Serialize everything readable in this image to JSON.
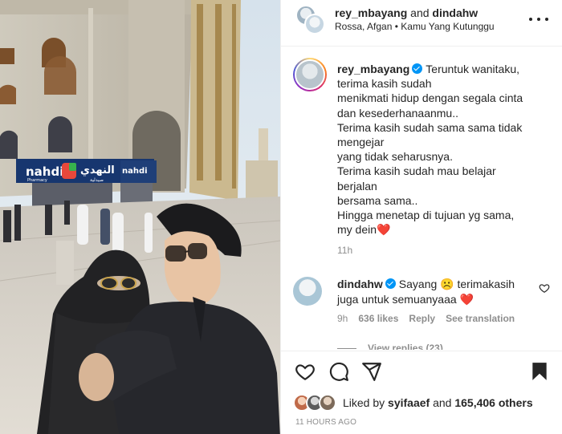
{
  "header": {
    "author": "rey_mbayang",
    "connector": "and",
    "coauthor": "dindahw",
    "location": "Rossa, Afgan",
    "separator": "•",
    "audio": "Kamu Yang Kutunggu"
  },
  "caption": {
    "username": "rey_mbayang",
    "lines": [
      "Teruntuk wanitaku,",
      "terima kasih sudah",
      "menikmati hidup dengan segala cinta",
      "dan kesederhanaanmu..",
      "Terima kasih sudah sama sama tidak",
      "mengejar",
      "yang tidak seharusnya.",
      "Terima kasih sudah mau belajar",
      "berjalan",
      "bersama sama..",
      "Hingga menetap di tujuan yg sama,",
      "my dein"
    ],
    "emoji_end": "❤️",
    "time": "11h"
  },
  "comment": {
    "username": "dindahw",
    "text_part1": "Sayang",
    "emoji_mid": "☹️",
    "text_part2": "terimakasih",
    "text_line2": "juga untuk semuanyaaa",
    "emoji_end": "❤️",
    "time": "9h",
    "likes": "636 likes",
    "reply": "Reply",
    "translate": "See translation",
    "view_replies": "View replies (23)"
  },
  "likes": {
    "prefix": "Liked by",
    "user": "syifaaef",
    "connector": "and",
    "count": "165,406 others"
  },
  "post_time": "11 HOURS AGO",
  "photo": {
    "sign_brand": "nahdi",
    "sign_sub": "Pharmacy",
    "sign_arabic": "النهدي",
    "sign_arabic2": "صيدلية",
    "sign_right": "nahdi"
  },
  "icons": [
    "more-options-icon",
    "heart-icon",
    "comment-icon",
    "share-icon",
    "bookmark-icon",
    "verified-icon"
  ],
  "colors": {
    "verified": "#0095f6",
    "heart": "#ed1c24",
    "muted": "#8e8e8e",
    "text": "#262626"
  }
}
